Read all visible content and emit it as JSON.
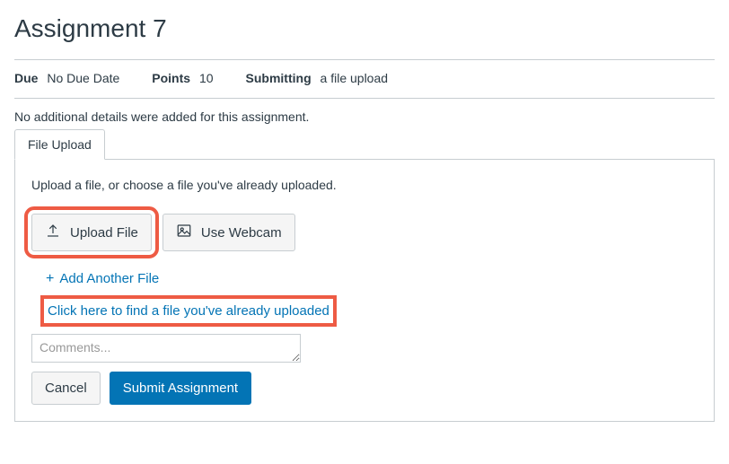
{
  "title": "Assignment 7",
  "meta": {
    "due_label": "Due",
    "due_value": "No Due Date",
    "points_label": "Points",
    "points_value": "10",
    "submitting_label": "Submitting",
    "submitting_value": "a file upload"
  },
  "details_text": "No additional details were added for this assignment.",
  "tab_label": "File Upload",
  "panel": {
    "hint": "Upload a file, or choose a file you've already uploaded.",
    "upload_btn": "Upload File",
    "webcam_btn": "Use Webcam",
    "add_another": "Add Another File",
    "find_link": "Click here to find a file you've already uploaded",
    "comments_placeholder": "Comments...",
    "cancel_btn": "Cancel",
    "submit_btn": "Submit Assignment"
  }
}
